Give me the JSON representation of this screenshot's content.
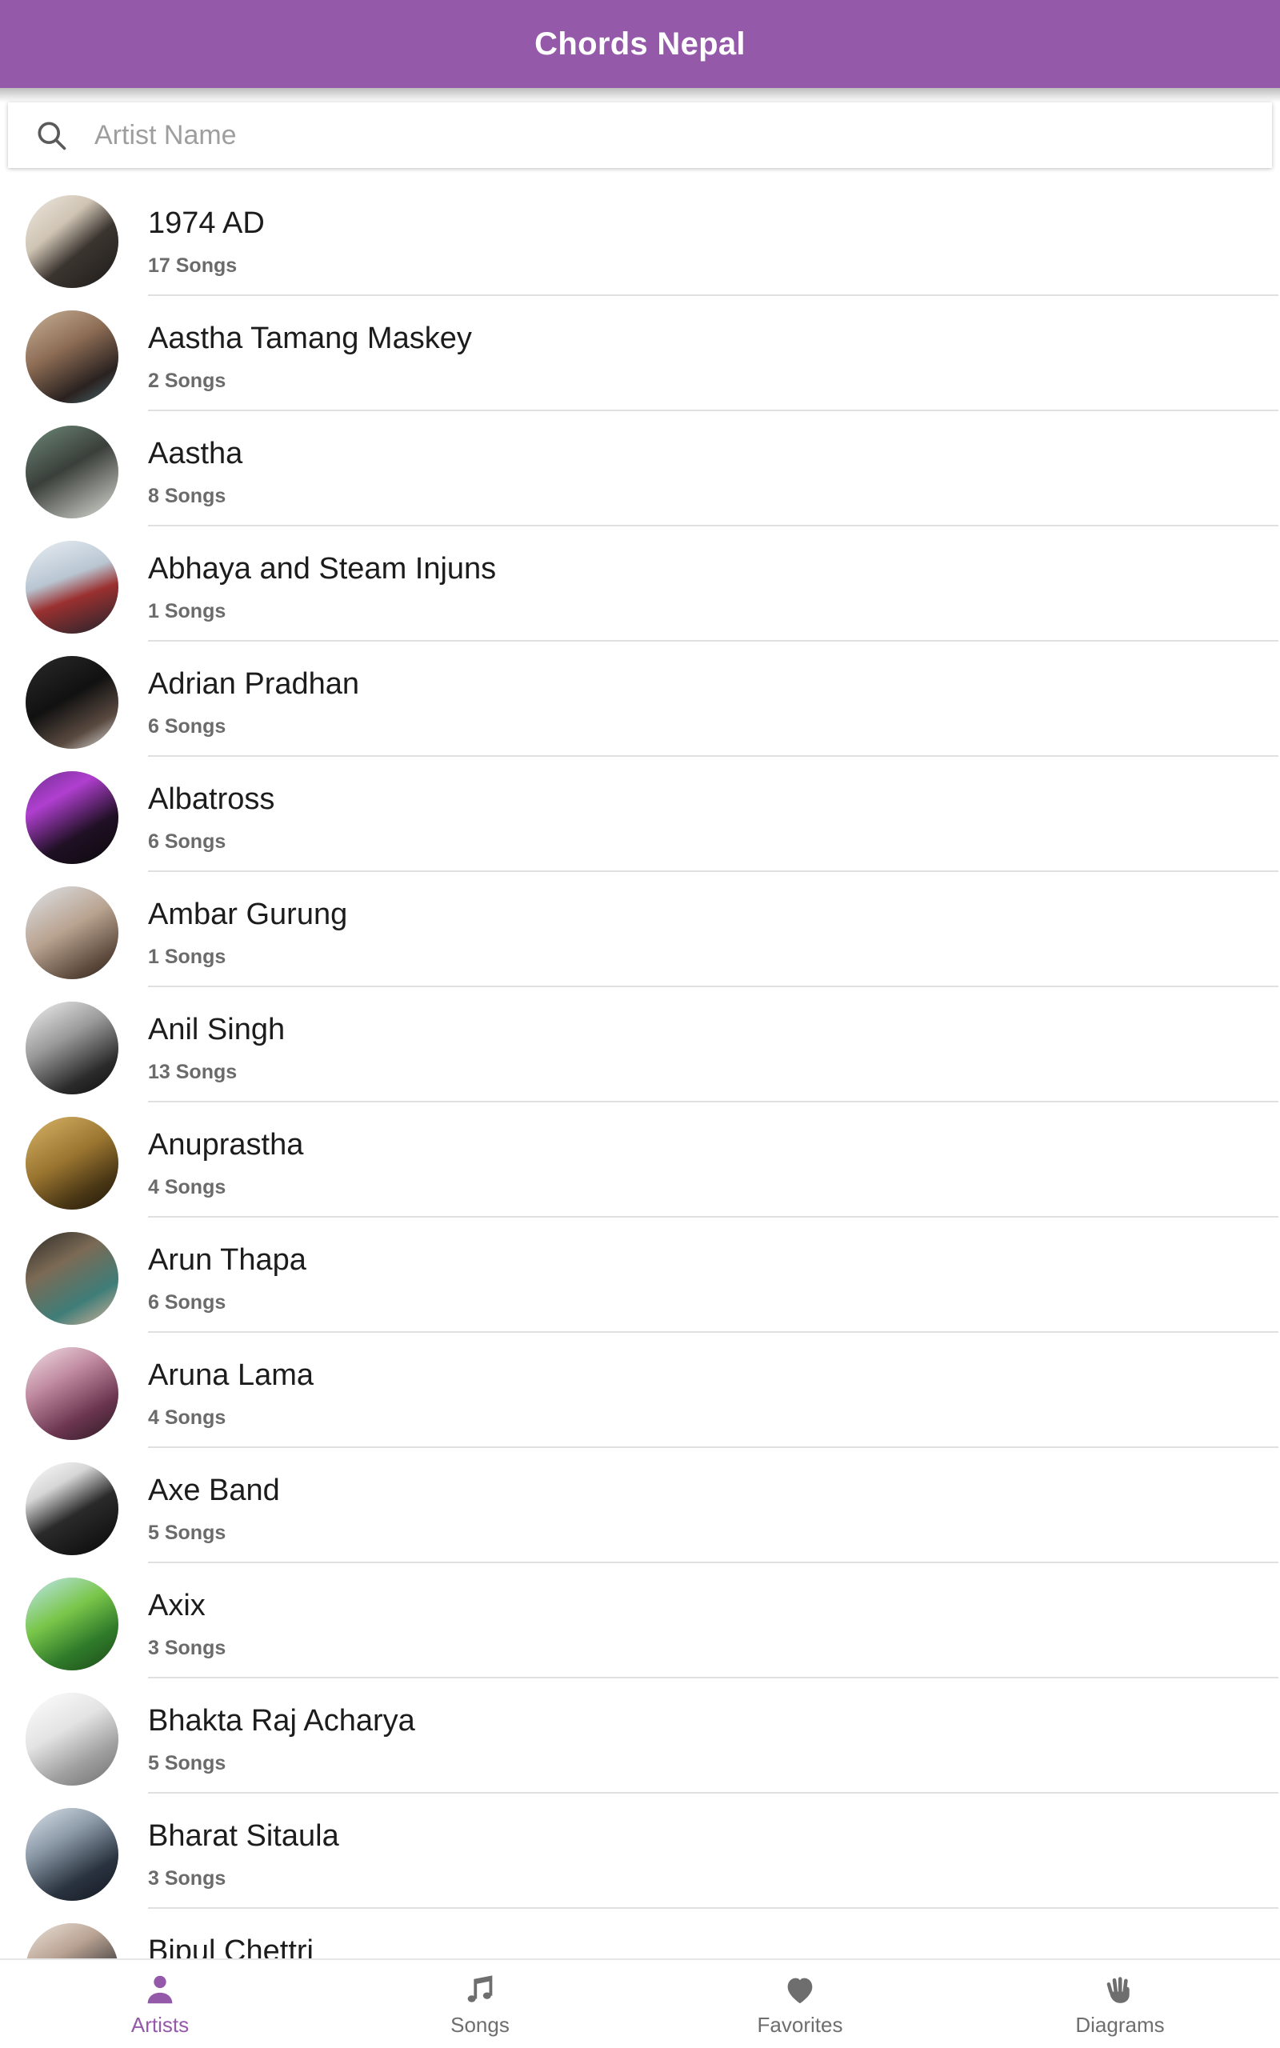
{
  "appbar": {
    "title": "Chords Nepal",
    "background": "#9459A8",
    "title_color": "#FFFFFF"
  },
  "search": {
    "placeholder": "Artist Name",
    "value": "",
    "icon": "search-icon"
  },
  "list": {
    "count_suffix": "Songs",
    "items": [
      {
        "name": "1974 AD",
        "songs": "17 Songs",
        "avatar": "band-group-photo"
      },
      {
        "name": "Aastha Tamang Maskey",
        "songs": "2 Songs",
        "avatar": "woman-portrait"
      },
      {
        "name": "Aastha",
        "songs": "8 Songs",
        "avatar": "couple-photo"
      },
      {
        "name": "Abhaya and Steam Injuns",
        "songs": "1 Songs",
        "avatar": "band-standing-photo"
      },
      {
        "name": "Adrian Pradhan",
        "songs": "6 Songs",
        "avatar": "man-dark-portrait"
      },
      {
        "name": "Albatross",
        "songs": "6 Songs",
        "avatar": "band-logo-purple"
      },
      {
        "name": "Ambar Gurung",
        "songs": "1 Songs",
        "avatar": "elder-man-glasses"
      },
      {
        "name": "Anil Singh",
        "songs": "13 Songs",
        "avatar": "man-sunglasses-bw"
      },
      {
        "name": "Anuprastha",
        "songs": "4 Songs",
        "avatar": "sepia-band-photo"
      },
      {
        "name": "Arun Thapa",
        "songs": "6 Songs",
        "avatar": "man-portrait-teal"
      },
      {
        "name": "Aruna Lama",
        "songs": "4 Songs",
        "avatar": "woman-smiling-portrait"
      },
      {
        "name": "Axe Band",
        "songs": "5 Songs",
        "avatar": "axe-band-bw-logo"
      },
      {
        "name": "Axix",
        "songs": "3 Songs",
        "avatar": "band-green-field"
      },
      {
        "name": "Bhakta Raj Acharya",
        "songs": "5 Songs",
        "avatar": "man-mustache-bw"
      },
      {
        "name": "Bharat Sitaula",
        "songs": "3 Songs",
        "avatar": "young-man-cap"
      },
      {
        "name": "Bipul Chettri",
        "songs": "",
        "avatar": "man-outdoor-portrait"
      }
    ]
  },
  "bottomnav": {
    "active_color": "#9459A8",
    "inactive_color": "#6E6E6E",
    "items": [
      {
        "label": "Artists",
        "icon": "person-icon",
        "active": true
      },
      {
        "label": "Songs",
        "icon": "music-note-icon",
        "active": false
      },
      {
        "label": "Favorites",
        "icon": "heart-icon",
        "active": false
      },
      {
        "label": "Diagrams",
        "icon": "hand-icon",
        "active": false
      }
    ]
  }
}
